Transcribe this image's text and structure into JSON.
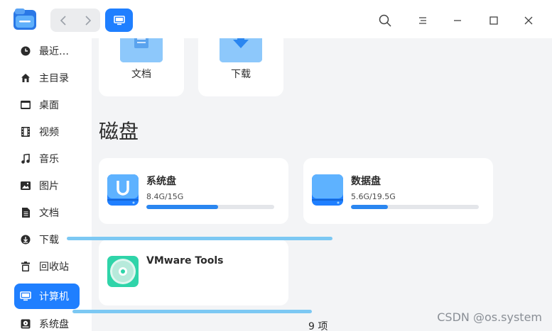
{
  "titlebar": {
    "app_icon": "file-manager-icon",
    "back_icon": "chevron-left-icon",
    "forward_icon": "chevron-right-icon",
    "view_icon": "computer-icon",
    "search_icon": "search-icon",
    "menu_icon": "menu-icon",
    "minimize_icon": "minimize-icon",
    "maximize_icon": "maximize-icon",
    "close_icon": "close-icon"
  },
  "sidebar": {
    "items": [
      {
        "label": "最近…",
        "icon": "clock-icon"
      },
      {
        "label": "主目录",
        "icon": "home-icon"
      },
      {
        "label": "桌面",
        "icon": "desktop-icon"
      },
      {
        "label": "视频",
        "icon": "video-icon"
      },
      {
        "label": "音乐",
        "icon": "music-icon"
      },
      {
        "label": "图片",
        "icon": "picture-icon"
      },
      {
        "label": "文档",
        "icon": "document-icon"
      },
      {
        "label": "下载",
        "icon": "download-icon"
      },
      {
        "label": "回收站",
        "icon": "trash-icon"
      },
      {
        "label": "计算机",
        "icon": "computer-icon"
      },
      {
        "label": "系统盘",
        "icon": "disk-icon"
      }
    ],
    "active": "计算机"
  },
  "main": {
    "folders": [
      {
        "label": "文档",
        "icon": "documents-folder-icon"
      },
      {
        "label": "下载",
        "icon": "downloads-folder-icon"
      }
    ],
    "section_title": "磁盘",
    "disks": [
      {
        "name": "系统盘",
        "size": "8.4G/15G",
        "usage": 0.56,
        "icon": "system-disk-icon"
      },
      {
        "name": "数据盘",
        "size": "5.6G/19.5G",
        "usage": 0.29,
        "icon": "data-disk-icon"
      },
      {
        "name": "VMware Tools",
        "size": "",
        "icon": "cd-disc-icon"
      }
    ],
    "status": "9 项"
  },
  "watermark": "CSDN @os.system",
  "colors": {
    "accent": "#1f7fff",
    "drag_line": "#7cc8f3",
    "progress": "#2a86f0"
  }
}
